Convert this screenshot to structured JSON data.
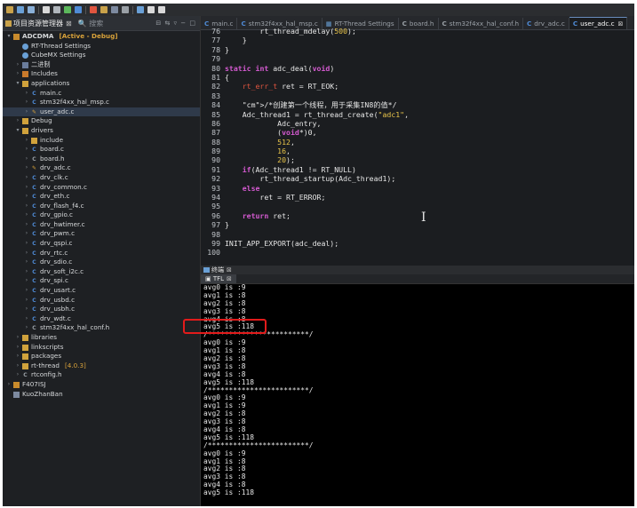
{
  "left_panel": {
    "tab_label": "项目资源管理器",
    "search_label": "搜索",
    "controls": "⊟ ⇆ ▿ − □"
  },
  "tree": [
    {
      "label": "ADCDMA",
      "tag": "[Active - Debug]",
      "depth": 0,
      "twisty": "▾",
      "icon": "project-icon",
      "bold": true
    },
    {
      "label": "RT-Thread Settings",
      "depth": 1,
      "icon": "settings-icon"
    },
    {
      "label": "CubeMX Settings",
      "depth": 1,
      "icon": "settings-icon"
    },
    {
      "label": "二进制",
      "depth": 1,
      "twisty": "›",
      "icon": "binary-icon"
    },
    {
      "label": "Includes",
      "depth": 1,
      "twisty": "›",
      "icon": "includes-icon"
    },
    {
      "label": "applications",
      "depth": 1,
      "twisty": "▾",
      "icon": "folder-icon"
    },
    {
      "label": "main.c",
      "depth": 2,
      "twisty": "›",
      "icon": "c-file-icon"
    },
    {
      "label": "stm32f4xx_hal_msp.c",
      "depth": 2,
      "twisty": "›",
      "icon": "c-file-icon"
    },
    {
      "label": "user_adc.c",
      "depth": 2,
      "twisty": "›",
      "icon": "edit-c-file-icon",
      "selected": true
    },
    {
      "label": "Debug",
      "depth": 1,
      "twisty": "›",
      "icon": "folder-icon"
    },
    {
      "label": "drivers",
      "depth": 1,
      "twisty": "▾",
      "icon": "folder-icon"
    },
    {
      "label": "include",
      "depth": 2,
      "twisty": "›",
      "icon": "folder-icon"
    },
    {
      "label": "board.c",
      "depth": 2,
      "twisty": "›",
      "icon": "c-file-icon"
    },
    {
      "label": "board.h",
      "depth": 2,
      "twisty": "›",
      "icon": "h-file-icon"
    },
    {
      "label": "drv_adc.c",
      "depth": 2,
      "twisty": "›",
      "icon": "edit-c-file-icon"
    },
    {
      "label": "drv_clk.c",
      "depth": 2,
      "twisty": "›",
      "icon": "c-file-icon"
    },
    {
      "label": "drv_common.c",
      "depth": 2,
      "twisty": "›",
      "icon": "c-file-icon"
    },
    {
      "label": "drv_eth.c",
      "depth": 2,
      "twisty": "›",
      "icon": "c-file-icon"
    },
    {
      "label": "drv_flash_f4.c",
      "depth": 2,
      "twisty": "›",
      "icon": "c-file-icon"
    },
    {
      "label": "drv_gpio.c",
      "depth": 2,
      "twisty": "›",
      "icon": "c-file-icon"
    },
    {
      "label": "drv_hwtimer.c",
      "depth": 2,
      "twisty": "›",
      "icon": "c-file-icon"
    },
    {
      "label": "drv_pwm.c",
      "depth": 2,
      "twisty": "›",
      "icon": "c-file-icon"
    },
    {
      "label": "drv_qspi.c",
      "depth": 2,
      "twisty": "›",
      "icon": "c-file-icon"
    },
    {
      "label": "drv_rtc.c",
      "depth": 2,
      "twisty": "›",
      "icon": "c-file-icon"
    },
    {
      "label": "drv_sdio.c",
      "depth": 2,
      "twisty": "›",
      "icon": "c-file-icon"
    },
    {
      "label": "drv_soft_i2c.c",
      "depth": 2,
      "twisty": "›",
      "icon": "c-file-icon"
    },
    {
      "label": "drv_spi.c",
      "depth": 2,
      "twisty": "›",
      "icon": "c-file-icon"
    },
    {
      "label": "drv_usart.c",
      "depth": 2,
      "twisty": "›",
      "icon": "c-file-icon"
    },
    {
      "label": "drv_usbd.c",
      "depth": 2,
      "twisty": "›",
      "icon": "c-file-icon"
    },
    {
      "label": "drv_usbh.c",
      "depth": 2,
      "twisty": "›",
      "icon": "c-file-icon"
    },
    {
      "label": "drv_wdt.c",
      "depth": 2,
      "twisty": "›",
      "icon": "c-file-icon"
    },
    {
      "label": "stm32f4xx_hal_conf.h",
      "depth": 2,
      "twisty": "›",
      "icon": "h-file-icon"
    },
    {
      "label": "libraries",
      "depth": 1,
      "twisty": "›",
      "icon": "folder-icon"
    },
    {
      "label": "linkscripts",
      "depth": 1,
      "twisty": "›",
      "icon": "folder-icon"
    },
    {
      "label": "packages",
      "depth": 1,
      "twisty": "›",
      "icon": "folder-icon"
    },
    {
      "label": "rt-thread",
      "tag": "[4.0.3]",
      "depth": 1,
      "twisty": "›",
      "icon": "folder-icon"
    },
    {
      "label": "rtconfig.h",
      "depth": 1,
      "twisty": "›",
      "icon": "h-file-icon"
    },
    {
      "label": "F407ISJ",
      "depth": 0,
      "twisty": "›",
      "icon": "project-icon"
    },
    {
      "label": "KuoZhanBan",
      "depth": 0,
      "icon": "document-icon"
    }
  ],
  "editor_tabs": [
    {
      "label": "main.c",
      "icon": "c-file-icon"
    },
    {
      "label": "stm32f4xx_hal_msp.c",
      "icon": "c-file-icon"
    },
    {
      "label": "RT-Thread Settings",
      "icon": "settings-icon"
    },
    {
      "label": "board.h",
      "icon": "h-file-icon"
    },
    {
      "label": "stm32f4xx_hal_conf.h",
      "icon": "h-file-icon"
    },
    {
      "label": "drv_adc.c",
      "icon": "c-file-icon"
    },
    {
      "label": "user_adc.c",
      "icon": "c-file-icon",
      "active": true,
      "close": "⊠"
    }
  ],
  "code_lines": [
    {
      "n": "76",
      "t": "        rt_thread_mdelay(500);"
    },
    {
      "n": "77",
      "t": "    }"
    },
    {
      "n": "78",
      "t": "}"
    },
    {
      "n": "79",
      "t": ""
    },
    {
      "n": "80",
      "t": "static int adc_deal(void)"
    },
    {
      "n": "81",
      "t": "{"
    },
    {
      "n": "82",
      "t": "    rt_err_t ret = RT_EOK;"
    },
    {
      "n": "83",
      "t": ""
    },
    {
      "n": "84",
      "t": "    /*创建第一个线程，用于采集IN8的值*/"
    },
    {
      "n": "85",
      "t": "    Adc_thread1 = rt_thread_create(\"adc1\","
    },
    {
      "n": "86",
      "t": "            Adc_entry,"
    },
    {
      "n": "87",
      "t": "            (void*)0,"
    },
    {
      "n": "88",
      "t": "            512,"
    },
    {
      "n": "89",
      "t": "            16,"
    },
    {
      "n": "90",
      "t": "            20);"
    },
    {
      "n": "91",
      "t": "    if(Adc_thread1 != RT_NULL)"
    },
    {
      "n": "92",
      "t": "        rt_thread_startup(Adc_thread1);"
    },
    {
      "n": "93",
      "t": "    else"
    },
    {
      "n": "94",
      "t": "        ret = RT_ERROR;"
    },
    {
      "n": "95",
      "t": ""
    },
    {
      "n": "96",
      "t": "    return ret;"
    },
    {
      "n": "97",
      "t": "}"
    },
    {
      "n": "98",
      "t": ""
    },
    {
      "n": "99",
      "t": "INIT_APP_EXPORT(adc_deal);"
    },
    {
      "n": "100",
      "t": ""
    }
  ],
  "console": {
    "header_label": "终端",
    "close": "⊠",
    "tab_label": "TFL",
    "lines": [
      "avg0 is :9",
      "avg1 is :8",
      "avg2 is :8",
      "avg3 is :8",
      "avg4 is :8",
      "avg5 is :118",
      "/************************/",
      "avg0 is :9",
      "avg1 is :8",
      "avg2 is :8",
      "avg3 is :8",
      "avg4 is :8",
      "avg5 is :118",
      "/************************/",
      "avg0 is :9",
      "avg1 is :9",
      "avg2 is :8",
      "avg3 is :8",
      "avg4 is :8",
      "avg5 is :118",
      "/************************/",
      "avg0 is :9",
      "avg1 is :8",
      "avg2 is :8",
      "avg3 is :8",
      "avg4 is :8",
      "avg5 is :118"
    ]
  },
  "colors": {
    "accent_folder": "#d0a23c",
    "c_file": "#4f8bd6",
    "highlight_box": "#e21b1b",
    "keyword": "#d45ad0",
    "type": "#e0553f",
    "string_comment": "#e8c44a"
  }
}
